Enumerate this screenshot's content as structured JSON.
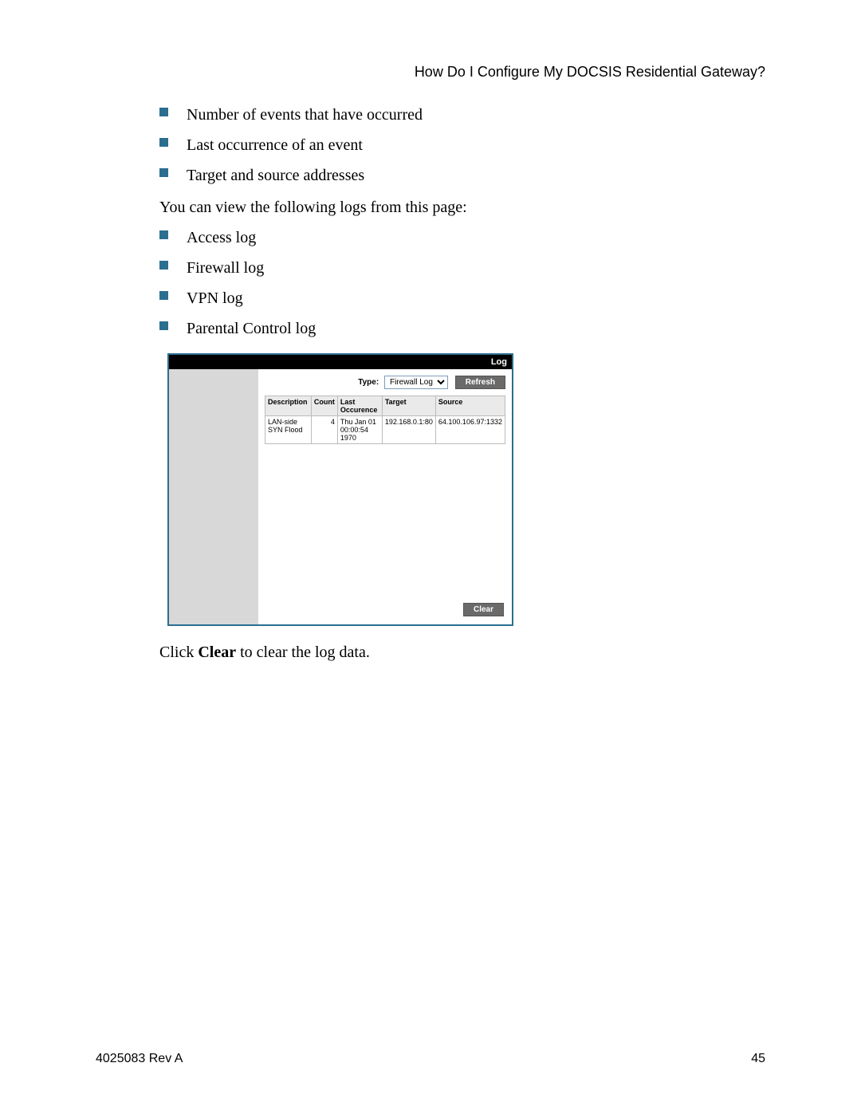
{
  "header": {
    "title": "How Do I Configure My DOCSIS Residential Gateway?"
  },
  "events_list": [
    "Number of events that have occurred",
    "Last occurrence of an event",
    "Target and source addresses"
  ],
  "view_logs_intro": "You can view the following logs from this page:",
  "logs_list": [
    "Access log",
    "Firewall log",
    "VPN log",
    "Parental Control log"
  ],
  "screenshot": {
    "title": "Log",
    "type_label": "Type:",
    "type_value": "Firewall Log",
    "refresh_label": "Refresh",
    "clear_label": "Clear",
    "columns": {
      "description": "Description",
      "count": "Count",
      "last_occurence": "Last Occurence",
      "target": "Target",
      "source": "Source"
    },
    "row": {
      "description": "LAN-side SYN Flood",
      "count": "4",
      "last_occurence": "Thu Jan 01 00:00:54 1970",
      "target": "192.168.0.1:80",
      "source": "64.100.106.97:1332"
    }
  },
  "clear_text_prefix": "Click ",
  "clear_text_bold": "Clear",
  "clear_text_suffix": " to clear the log data.",
  "footer": {
    "left": "4025083 Rev A",
    "right": "45"
  }
}
